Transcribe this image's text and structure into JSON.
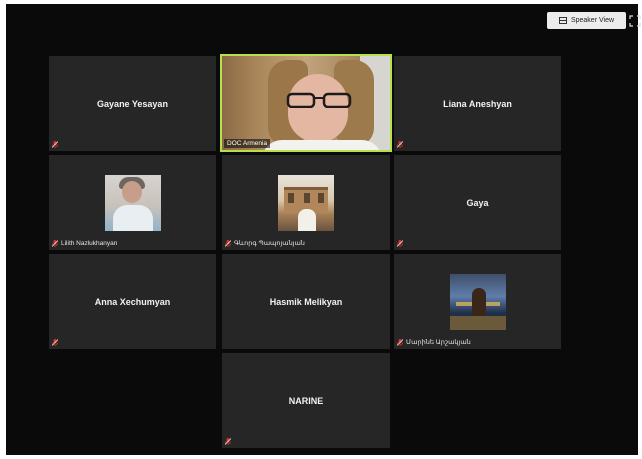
{
  "toolbar": {
    "speaker_view_label": "Speaker View"
  },
  "participants": [
    {
      "name": "Gayane Yesayan"
    },
    {
      "name": "DOC Armenia"
    },
    {
      "name": "Liana Aneshyan"
    },
    {
      "name": "Lilith Nazlukhanyan"
    },
    {
      "name": "Գևորգ Պապոյանյան"
    },
    {
      "name": "Gaya"
    },
    {
      "name": "Anna Xechumyan"
    },
    {
      "name": "Hasmik Melikyan"
    },
    {
      "name": "Մարինե Արշակյան"
    },
    {
      "name": "NARINE"
    }
  ],
  "colors": {
    "active_speaker_border": "#b7e14b",
    "mute_icon": "#e0312b",
    "tile_bg": "#262626"
  }
}
